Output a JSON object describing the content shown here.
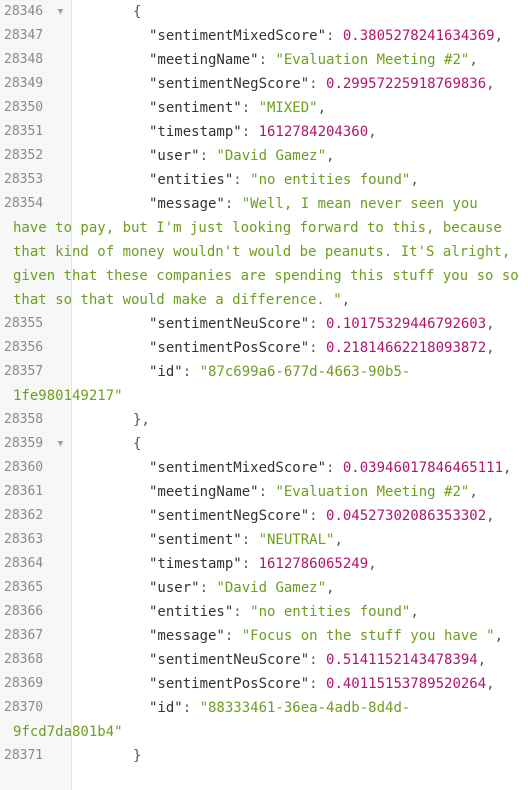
{
  "lines": [
    {
      "n": "28346",
      "type": "brace",
      "text": "{",
      "fold": true
    },
    {
      "n": "28347",
      "type": "kv",
      "key": "\"sentimentMixedScore\"",
      "val": "0.3805278241634369",
      "vt": "num"
    },
    {
      "n": "28348",
      "type": "kv",
      "key": "\"meetingName\"",
      "val": "\"Evaluation Meeting #2\"",
      "vt": "str"
    },
    {
      "n": "28349",
      "type": "kv",
      "key": "\"sentimentNegScore\"",
      "val": "0.29957225918769836",
      "vt": "num"
    },
    {
      "n": "28350",
      "type": "kv",
      "key": "\"sentiment\"",
      "val": "\"MIXED\"",
      "vt": "str"
    },
    {
      "n": "28351",
      "type": "kv",
      "key": "\"timestamp\"",
      "val": "1612784204360",
      "vt": "num"
    },
    {
      "n": "28352",
      "type": "kv",
      "key": "\"user\"",
      "val": "\"David Gamez\"",
      "vt": "str"
    },
    {
      "n": "28353",
      "type": "kv",
      "key": "\"entities\"",
      "val": "\"no entities found\"",
      "vt": "str"
    },
    {
      "n": "28354",
      "type": "kvwrap",
      "key": "\"message\"",
      "val_first": "\"Well, I mean never seen you",
      "val_rest": "have to pay, but I'm just looking forward to this, because that kind of money wouldn't would be peanuts. It'S alright, given that these companies are spending this stuff you so so that so that would make a difference. \"",
      "vt": "str"
    },
    {
      "n": "28355",
      "type": "kv",
      "key": "\"sentimentNeuScore\"",
      "val": "0.10175329446792603",
      "vt": "num"
    },
    {
      "n": "28356",
      "type": "kv",
      "key": "\"sentimentPosScore\"",
      "val": "0.21814662218093872",
      "vt": "num"
    },
    {
      "n": "28357",
      "type": "kvwrap",
      "key": "\"id\"",
      "val_first": "\"87c699a6-677d-4663-90b5-",
      "val_rest": "1fe980149217\"",
      "vt": "str",
      "last": true
    },
    {
      "n": "28358",
      "type": "brace",
      "text": "},",
      "fold": false
    },
    {
      "n": "28359",
      "type": "brace",
      "text": "{",
      "fold": true
    },
    {
      "n": "28360",
      "type": "kv",
      "key": "\"sentimentMixedScore\"",
      "val": "0.03946017846465111",
      "vt": "num"
    },
    {
      "n": "28361",
      "type": "kv",
      "key": "\"meetingName\"",
      "val": "\"Evaluation Meeting #2\"",
      "vt": "str"
    },
    {
      "n": "28362",
      "type": "kv",
      "key": "\"sentimentNegScore\"",
      "val": "0.04527302086353302",
      "vt": "num"
    },
    {
      "n": "28363",
      "type": "kv",
      "key": "\"sentiment\"",
      "val": "\"NEUTRAL\"",
      "vt": "str"
    },
    {
      "n": "28364",
      "type": "kv",
      "key": "\"timestamp\"",
      "val": "1612786065249",
      "vt": "num"
    },
    {
      "n": "28365",
      "type": "kv",
      "key": "\"user\"",
      "val": "\"David Gamez\"",
      "vt": "str"
    },
    {
      "n": "28366",
      "type": "kv",
      "key": "\"entities\"",
      "val": "\"no entities found\"",
      "vt": "str"
    },
    {
      "n": "28367",
      "type": "kv",
      "key": "\"message\"",
      "val": "\"Focus on the stuff you have \"",
      "vt": "str"
    },
    {
      "n": "28368",
      "type": "kv",
      "key": "\"sentimentNeuScore\"",
      "val": "0.5141152143478394",
      "vt": "num"
    },
    {
      "n": "28369",
      "type": "kv",
      "key": "\"sentimentPosScore\"",
      "val": "0.40115153789520264",
      "vt": "num"
    },
    {
      "n": "28370",
      "type": "kvwrap",
      "key": "\"id\"",
      "val_first": "\"88333461-36ea-4adb-8d4d-",
      "val_rest": "9fcd7da801b4\"",
      "vt": "str",
      "last": true
    },
    {
      "n": "28371",
      "type": "brace",
      "text": "}",
      "fold": false
    }
  ],
  "colors": {
    "key": "#333333",
    "string": "#6d9e1f",
    "number": "#b0156d",
    "gutter_bg": "#f7f7f7",
    "line_number": "#8a8a8a"
  },
  "icons": {
    "fold": "fold-arrow-icon"
  }
}
